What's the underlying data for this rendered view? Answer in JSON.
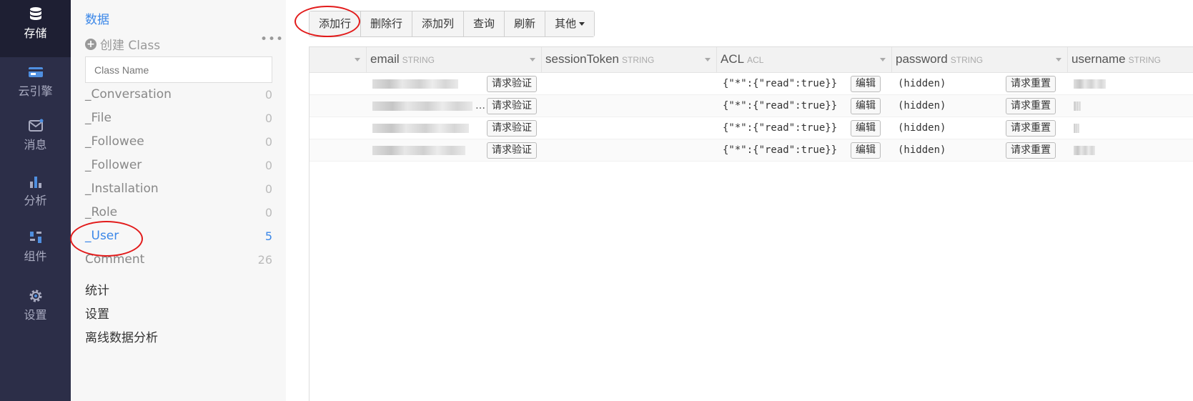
{
  "rail": {
    "items": [
      {
        "label": "存储",
        "icon": "database-icon",
        "active": true
      },
      {
        "label": "云引擎",
        "icon": "engine-icon"
      },
      {
        "label": "消息",
        "icon": "message-icon"
      },
      {
        "label": "分析",
        "icon": "bar-chart-icon"
      },
      {
        "label": "组件",
        "icon": "components-icon"
      },
      {
        "label": "设置",
        "icon": "gear-icon"
      }
    ]
  },
  "classpanel": {
    "title": "数据",
    "create_label": "创建 Class",
    "more_label": "•••",
    "search_placeholder": "Class Name",
    "classes": [
      {
        "name": "_Conversation",
        "count": "0"
      },
      {
        "name": "_File",
        "count": "0"
      },
      {
        "name": "_Followee",
        "count": "0"
      },
      {
        "name": "_Follower",
        "count": "0"
      },
      {
        "name": "_Installation",
        "count": "0"
      },
      {
        "name": "_Role",
        "count": "0"
      },
      {
        "name": "_User",
        "count": "5",
        "active": true
      },
      {
        "name": "Comment",
        "count": "26"
      }
    ],
    "links": [
      "统计",
      "设置",
      "离线数据分析"
    ]
  },
  "toolbar": {
    "buttons": [
      "添加行",
      "删除行",
      "添加列",
      "查询",
      "刷新",
      "其他"
    ]
  },
  "grid": {
    "columns": [
      {
        "name": "email",
        "type": "STRING"
      },
      {
        "name": "sessionToken",
        "type": "STRING"
      },
      {
        "name": "ACL",
        "type": "ACL"
      },
      {
        "name": "password",
        "type": "STRING"
      },
      {
        "name": "username",
        "type": "STRING"
      }
    ],
    "verify_label": "请求验证",
    "edit_label": "编辑",
    "reset_label": "请求重置",
    "rows": [
      {
        "acl": "{\"*\":{\"read\":true}}",
        "password": "(hidden)"
      },
      {
        "acl": "{\"*\":{\"read\":true}}",
        "password": "(hidden)",
        "email_ellipsis": "…"
      },
      {
        "acl": "{\"*\":{\"read\":true}}",
        "password": "(hidden)"
      },
      {
        "acl": "{\"*\":{\"read\":true}}",
        "password": "(hidden)"
      }
    ]
  },
  "colors": {
    "rail_bg": "#2c2e48",
    "accent": "#3b87e8",
    "annotation": "#e21b1b"
  }
}
